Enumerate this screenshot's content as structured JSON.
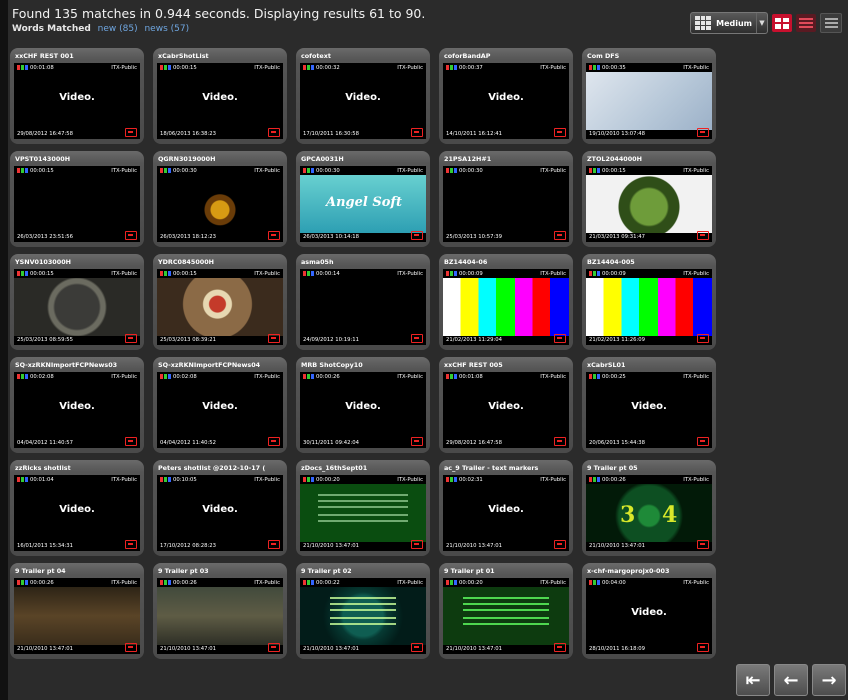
{
  "header": {
    "summary": "Found 135 matches in 0.944 seconds. Displaying results 61 to 90.",
    "words_label": "Words Matched",
    "words": [
      "new (85)",
      "news (57)"
    ]
  },
  "view": {
    "size_label": "Medium",
    "size_icon": "grid-icon",
    "modes": [
      "thumbnail-view-icon",
      "list-view-icon",
      "detail-view-icon"
    ]
  },
  "assets": [
    {
      "title": "xxCHF REST 001",
      "tc": "00:01:08",
      "pub": "ITX-Public",
      "date": "29/08/2012 16:47:58",
      "img": "video"
    },
    {
      "title": "xCabrShotList",
      "tc": "00:00:15",
      "pub": "ITX-Public",
      "date": "18/06/2013 16:38:23",
      "img": "video"
    },
    {
      "title": "cofotext",
      "tc": "00:00:32",
      "pub": "ITX-Public",
      "date": "17/10/2011 16:30:58",
      "img": "video"
    },
    {
      "title": "coforBandAP",
      "tc": "00:00:37",
      "pub": "ITX-Public",
      "date": "14/10/2011 16:12:41",
      "img": "video"
    },
    {
      "title": "Com DFS",
      "tc": "00:00:35",
      "pub": "ITX-Public",
      "date": "19/10/2010 13:07:48",
      "img": "dfs"
    },
    {
      "title": "VPST0143000H",
      "tc": "00:00:15",
      "pub": "ITX-Public",
      "date": "26/03/2013 23:51:56",
      "img": "black"
    },
    {
      "title": "QGRN3019000H",
      "tc": "00:00:30",
      "pub": "ITX-Public",
      "date": "26/03/2013 18:12:23",
      "img": "sunflower"
    },
    {
      "title": "GPCA0031H",
      "tc": "00:00:30",
      "pub": "ITX-Public",
      "date": "26/03/2013 10:14:18",
      "img": "angel",
      "img_text": "Angel Soft"
    },
    {
      "title": "21PSA12H#1",
      "tc": "00:00:30",
      "pub": "ITX-Public",
      "date": "25/03/2013 10:57:39",
      "img": "black"
    },
    {
      "title": "ZTOL2044000H",
      "tc": "00:00:15",
      "pub": "ITX-Public",
      "date": "21/03/2013 09:31:47",
      "img": "plant"
    },
    {
      "title": "YSNV0103000H",
      "tc": "00:00:15",
      "pub": "ITX-Public",
      "date": "25/03/2013 08:59:55",
      "img": "food1"
    },
    {
      "title": "YDRC0845000H",
      "tc": "00:00:15",
      "pub": "ITX-Public",
      "date": "25/03/2013 08:39:21",
      "img": "food2"
    },
    {
      "title": "asma05h",
      "tc": "00:00:14",
      "pub": "ITX-Public",
      "date": "24/09/2012 10:19:11",
      "img": "black"
    },
    {
      "title": "BZ14404-06",
      "tc": "00:00:09",
      "pub": "ITX-Public",
      "date": "21/02/2013 11:29:04",
      "img": "bars"
    },
    {
      "title": "BZ14404-005",
      "tc": "00:00:09",
      "pub": "ITX-Public",
      "date": "21/02/2013 11:26:09",
      "img": "bars2"
    },
    {
      "title": "SQ-xzRKNImportFCPNews03",
      "tc": "00:02:08",
      "pub": "ITX-Public",
      "date": "04/04/2012 11:40:57",
      "img": "video"
    },
    {
      "title": "SQ-xzRKNImportFCPNews04",
      "tc": "00:02:08",
      "pub": "ITX-Public",
      "date": "04/04/2012 11:40:52",
      "img": "video"
    },
    {
      "title": "MRB ShotCopy10",
      "tc": "00:00:26",
      "pub": "ITX-Public",
      "date": "30/11/2011 09:42:04",
      "img": "video"
    },
    {
      "title": "xxCHF REST 005",
      "tc": "00:01:08",
      "pub": "ITX-Public",
      "date": "29/08/2012 16:47:58",
      "img": "video"
    },
    {
      "title": "xCabrSL01",
      "tc": "00:00:25",
      "pub": "ITX-Public",
      "date": "20/06/2013 15:44:38",
      "img": "video"
    },
    {
      "title": "zzRicks shotlist",
      "tc": "00:01:04",
      "pub": "ITX-Public",
      "date": "16/01/2013 15:34:31",
      "img": "video"
    },
    {
      "title": "Peters shotlist @2012-10-17 (",
      "tc": "00:10:05",
      "pub": "ITX-Public",
      "date": "17/10/2012 08:28:23",
      "img": "video"
    },
    {
      "title": "zDocs_16thSept01",
      "tc": "00:00:20",
      "pub": "ITX-Public",
      "date": "21/10/2010 13:47:01",
      "img": "green"
    },
    {
      "title": "ac_9 Trailer - text markers",
      "tc": "00:02:31",
      "pub": "ITX-Public",
      "date": "21/10/2010 13:47:01",
      "img": "video"
    },
    {
      "title": "9 Trailer pt 05",
      "tc": "00:00:26",
      "pub": "ITX-Public",
      "date": "21/10/2010 13:47:01",
      "img": "n34",
      "img_text": [
        "3",
        "4"
      ]
    },
    {
      "title": "9 Trailer pt 04",
      "tc": "00:00:26",
      "pub": "ITX-Public",
      "date": "21/10/2010 13:47:01",
      "img": "brown1"
    },
    {
      "title": "9 Trailer pt 03",
      "tc": "00:00:26",
      "pub": "ITX-Public",
      "date": "21/10/2010 13:47:01",
      "img": "brown2"
    },
    {
      "title": "9 Trailer pt 02",
      "tc": "00:00:22",
      "pub": "ITX-Public",
      "date": "21/10/2010 13:47:01",
      "img": "teal"
    },
    {
      "title": "9 Trailer pt 01",
      "tc": "00:00:20",
      "pub": "ITX-Public",
      "date": "21/10/2010 13:47:01",
      "img": "green2"
    },
    {
      "title": "x-chf-margoprojx0-003",
      "tc": "00:04:00",
      "pub": "ITX-Public",
      "date": "28/10/2011 16:18:09",
      "img": "video"
    }
  ],
  "placeholder_text": "Video.",
  "pager": [
    "first-page-icon",
    "previous-page-icon",
    "next-page-icon"
  ]
}
